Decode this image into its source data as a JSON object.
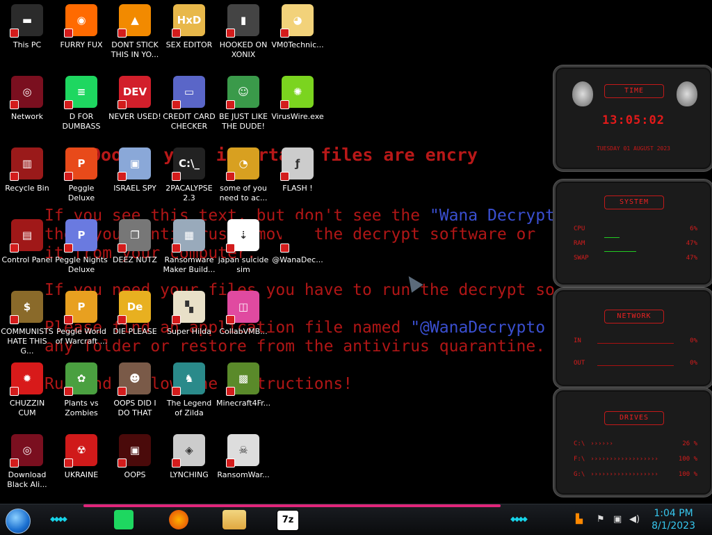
{
  "wallpaper": {
    "title": "Ooops, your important files are encry",
    "line1a": "If you see this text, but don't see the ",
    "line1b": "\"Wana Decrypt",
    "line2": "then your antivirus removed the decrypt software or",
    "line3": "it from your computer.",
    "line4": "If you need your files you have to run the decrypt so",
    "line5a": "Please find an application file named ",
    "line5b": "\"@WanaDecrypto",
    "line6": "any folder or restore from the antivirus quarantine.",
    "line7": "Run and follow the instructions!"
  },
  "icons": [
    {
      "label": "This PC",
      "icon": "computer-icon",
      "color": "#2b2b2b",
      "glyph": "▬"
    },
    {
      "label": "FURRY FUX",
      "icon": "firefox-icon",
      "color": "#ff6a00",
      "glyph": "◉"
    },
    {
      "label": "DONT STICK THIS IN YO...",
      "icon": "vlc-cone-icon",
      "color": "#f28a00",
      "glyph": "▲"
    },
    {
      "label": "SEX EDITOR",
      "icon": "hex-editor-icon",
      "color": "#e8b84a",
      "glyph": "HxD"
    },
    {
      "label": "HOOKED ON XONIX",
      "icon": "xonix-icon",
      "color": "#444",
      "glyph": "▮"
    },
    {
      "label": "VM0Technic...",
      "icon": "cartoon-icon",
      "color": "#f2d27a",
      "glyph": "◕"
    },
    {
      "label": "Network",
      "icon": "network-icon",
      "color": "#7a0f1f",
      "glyph": "◎"
    },
    {
      "label": "D FOR DUMBASS",
      "icon": "spotify-icon",
      "color": "#1ed760",
      "glyph": "≡"
    },
    {
      "label": "NEVER USED!",
      "icon": "devcpp-icon",
      "color": "#d21f2b",
      "glyph": "DEV"
    },
    {
      "label": "CREDIT CARD CHECKER",
      "icon": "credit-card-icon",
      "color": "#5a66c8",
      "glyph": "▭"
    },
    {
      "label": "BE JUST LIKE THE DUDE!",
      "icon": "elf-icon",
      "color": "#3a9a4a",
      "glyph": "☺"
    },
    {
      "label": "VirusWire.exe",
      "icon": "limewire-icon",
      "color": "#7bd41f",
      "glyph": "✺"
    },
    {
      "label": "Recycle Bin",
      "icon": "recycle-bin-icon",
      "color": "#9a1a1a",
      "glyph": "▥"
    },
    {
      "label": "Peggle Deluxe",
      "icon": "peggle-icon",
      "color": "#e84a1a",
      "glyph": "P"
    },
    {
      "label": "ISRAEL SPY",
      "icon": "spy-monitor-icon",
      "color": "#8aa8d8",
      "glyph": "▣"
    },
    {
      "label": "2PACALYPSE 2.3",
      "icon": "terminal-icon",
      "color": "#222",
      "glyph": "C:\\_"
    },
    {
      "label": "some of you need to ac...",
      "icon": "dog-icon",
      "color": "#d8a020",
      "glyph": "◔"
    },
    {
      "label": "FLASH !",
      "icon": "flash-icon",
      "color": "#cccccc",
      "glyph": "ƒ"
    },
    {
      "label": "Control Panel",
      "icon": "control-panel-icon",
      "color": "#a01818",
      "glyph": "▤"
    },
    {
      "label": "Peggle Nights Deluxe",
      "icon": "peggle-nights-icon",
      "color": "#6a7ae0",
      "glyph": "P"
    },
    {
      "label": "DEEZ NUTZ",
      "icon": "windows-stack-icon",
      "color": "#777",
      "glyph": "❐"
    },
    {
      "label": "Ransomware Maker Build...",
      "icon": "builder-window-icon",
      "color": "#9ab",
      "glyph": "▦"
    },
    {
      "label": "japan suicide sim",
      "icon": "file-icon",
      "color": "#ffffff",
      "glyph": "⇣"
    },
    {
      "label": "@WanaDec...",
      "icon": "wanacry-icon",
      "color": "#000",
      "glyph": ""
    },
    {
      "label": "COMMUNISTS HATE THIS G...",
      "icon": "money-bag-icon",
      "color": "#8a6a2a",
      "glyph": "$"
    },
    {
      "label": "Peggle World of Warcraft ...",
      "icon": "peggle-wow-icon",
      "color": "#e8a020",
      "glyph": "P"
    },
    {
      "label": "DIE PLEASE",
      "icon": "de-icon",
      "color": "#e8b020",
      "glyph": "De"
    },
    {
      "label": "Super Hilda",
      "icon": "pixel-dog-icon",
      "color": "#e8e0c8",
      "glyph": "▚"
    },
    {
      "label": "CollabVMB...",
      "icon": "collab-icon",
      "color": "#e04aa0",
      "glyph": "◫"
    },
    {
      "label": "CHUZZIN CUM",
      "icon": "chuzzle-icon",
      "color": "#d81a1a",
      "glyph": "✹"
    },
    {
      "label": "Plants vs Zombies",
      "icon": "plant-icon",
      "color": "#4aa040",
      "glyph": "✿"
    },
    {
      "label": "OOPS DID I DO THAT",
      "icon": "portrait-icon",
      "color": "#7a5a48",
      "glyph": "☻"
    },
    {
      "label": "The Legend of Zilda",
      "icon": "zelda-icon",
      "color": "#2a8a8a",
      "glyph": "♞"
    },
    {
      "label": "Minecraft4Fr...",
      "icon": "minecraft-icon",
      "color": "#5a8a2a",
      "glyph": "▩"
    },
    {
      "label": "Download Black Ali...",
      "icon": "alien-icon",
      "color": "#7a0f1f",
      "glyph": "◎"
    },
    {
      "label": "UKRAINE",
      "icon": "radiation-icon",
      "color": "#d01a1a",
      "glyph": "☢"
    },
    {
      "label": "OOPS",
      "icon": "screen-icon",
      "color": "#4a0a0a",
      "glyph": "▣"
    },
    {
      "label": "LYNCHING",
      "icon": "lynch-icon",
      "color": "#ccc",
      "glyph": "◈"
    },
    {
      "label": "RansomWar...",
      "icon": "skull-icon",
      "color": "#ddd",
      "glyph": "☠"
    }
  ],
  "gadgets": {
    "time": {
      "head": "TIME",
      "clock": "13:05:02",
      "date": "TUESDAY 01 AUGUST 2023"
    },
    "system": {
      "head": "SYSTEM",
      "rows": [
        {
          "k": "CPU",
          "v": "6%"
        },
        {
          "k": "RAM",
          "v": "47%"
        },
        {
          "k": "SWAP",
          "v": "47%"
        }
      ]
    },
    "network": {
      "head": "NETWORK",
      "rows": [
        {
          "k": "IN",
          "v": "0%"
        },
        {
          "k": "OUT",
          "v": "0%"
        }
      ]
    },
    "drives": {
      "head": "DRIVES",
      "rows": [
        {
          "k": "C:\\",
          "v": "26 %"
        },
        {
          "k": "F:\\",
          "v": "100 %"
        },
        {
          "k": "G:\\",
          "v": "100 %"
        }
      ]
    }
  },
  "taskbar": {
    "time": "1:04 PM",
    "date": "8/1/2023",
    "sevenzip": "7z"
  }
}
